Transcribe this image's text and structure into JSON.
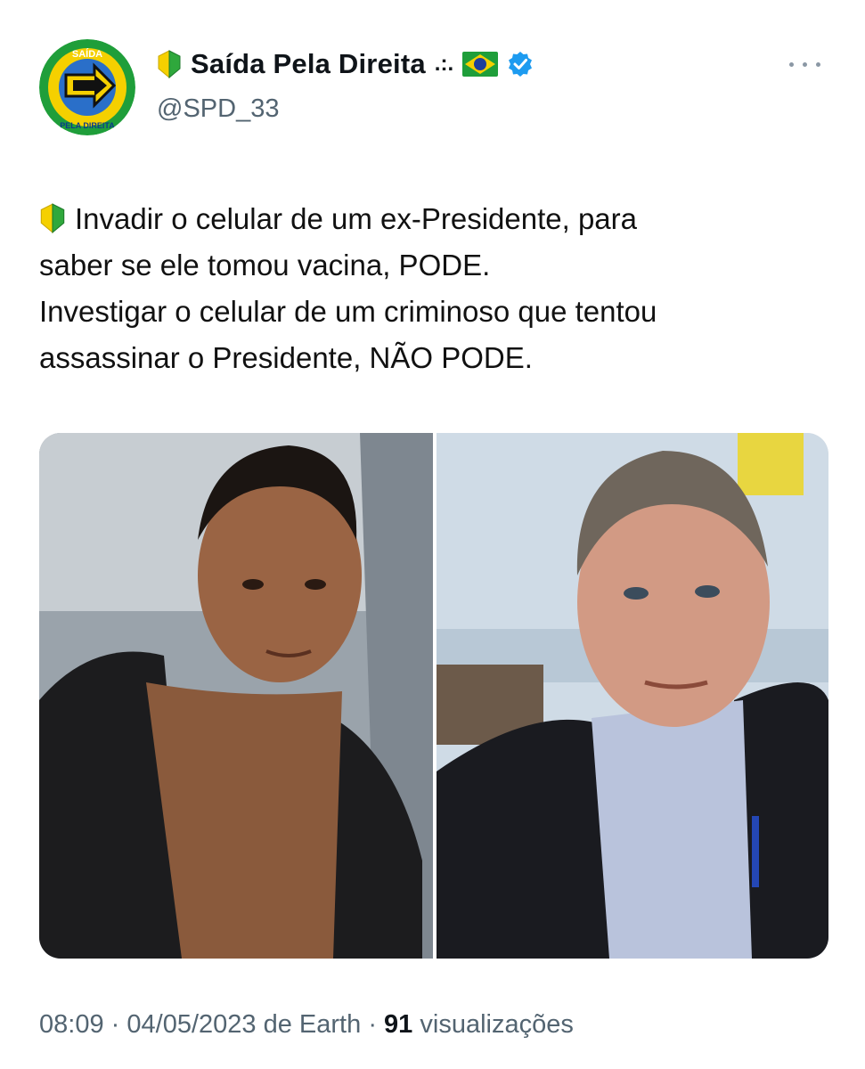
{
  "account": {
    "name_prefix_icon": "beginner-shield-icon",
    "display_name": "Saída Pela Direita",
    "name_suffix": ".:.",
    "flag_icon": "brazil-flag-icon",
    "verified_icon": "verified-badge-icon",
    "handle": "@SPD_33",
    "avatar_text_top": "SAÍDA",
    "avatar_text_bottom": "PELA DIREITA"
  },
  "tweet": {
    "lead_icon": "beginner-shield-icon",
    "lines": [
      "Invadir o celular de um ex-Presidente, para",
      "saber se ele tomou vacina, PODE.",
      "Investigar o celular de um criminoso que tentou",
      "assassinar o Presidente, NÃO PODE."
    ]
  },
  "media": {
    "description_icon": "photo-collage-icon"
  },
  "meta": {
    "time": "08:09",
    "sep1": "·",
    "date": "04/05/2023",
    "source_prefix": "de",
    "source": "Earth",
    "sep2": "·",
    "views_count": "91",
    "views_label": "visualizações"
  },
  "colors": {
    "verified": "#1d9bf0",
    "secondary_text": "#536471",
    "primary_text": "#0f1419",
    "brand_green": "#1f9e3a",
    "brand_yellow": "#f5d000"
  }
}
